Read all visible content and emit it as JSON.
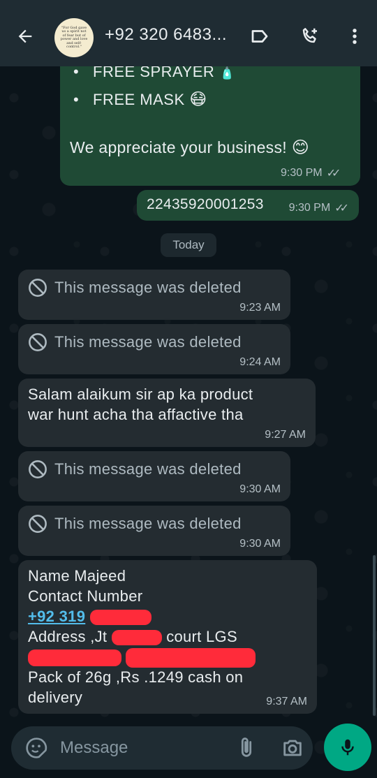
{
  "header": {
    "contact_name": "+92 320 6483...",
    "avatar_text": "\"For God gave us a spirit not of fear but of power and love and self-control.\"",
    "back_icon": "arrow-left-icon",
    "label_icon": "label-icon",
    "call_icon": "add-call-icon",
    "menu_icon": "more-vert-icon"
  },
  "messages": {
    "promo": {
      "item1": "FREE SPRAYER",
      "item1_emoji": "🧴",
      "item2": "FREE MASK",
      "item2_emoji": "😷",
      "closing": "We appreciate your business!",
      "closing_emoji": "😊",
      "time": "9:30 PM"
    },
    "tracking": {
      "text": "22435920001253",
      "time": "9:30 PM"
    },
    "date_divider": "Today",
    "deleted1": {
      "text": "This message was deleted",
      "time": "9:23 AM"
    },
    "deleted2": {
      "text": "This message was deleted",
      "time": "9:24 AM"
    },
    "salam": {
      "line1": "Salam alaikum sir ap ka product",
      "line2": "war hunt acha tha affactive tha",
      "time": "9:27 AM"
    },
    "deleted3": {
      "text": "This message was deleted",
      "time": "9:30 AM"
    },
    "deleted4": {
      "text": "This message was deleted",
      "time": "9:30 AM"
    },
    "order": {
      "line1": "Name Majeed",
      "line2": "Contact Number",
      "phone": "+92 319",
      "address_prefix": "Address ,Jt",
      "address_suffix": "court LGS",
      "line5": "Pack of 26g ,Rs .1249 cash on",
      "line6": "delivery",
      "time": "9:37 AM"
    }
  },
  "composer": {
    "placeholder": "Message"
  },
  "colors": {
    "outgoing_bubble": "#1f4a35",
    "incoming_bubble": "#242c31",
    "accent": "#00a884",
    "link": "#53bdeb",
    "redaction": "#ff2b3a"
  }
}
